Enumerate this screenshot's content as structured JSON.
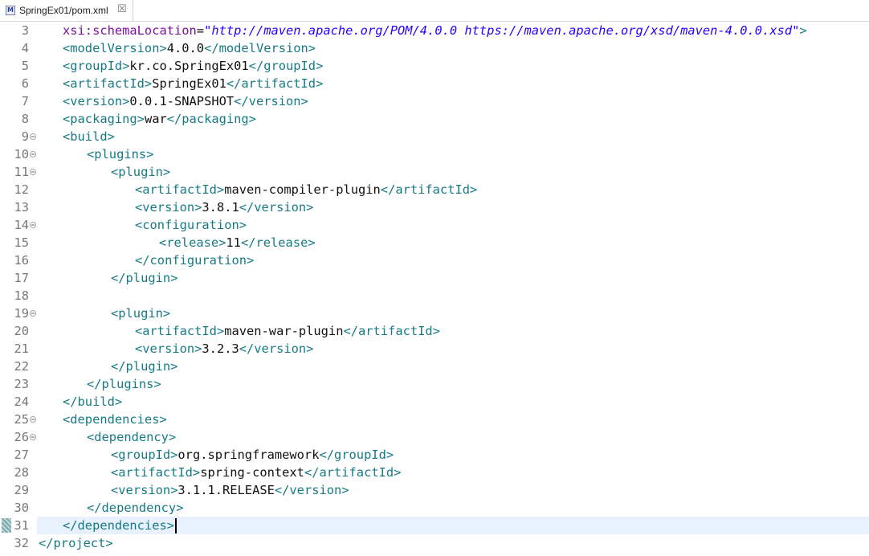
{
  "tab": {
    "title": "SpringEx01/pom.xml",
    "icon": "maven-file-icon",
    "icon_letter": "M",
    "close_symbol": "☒"
  },
  "current_line": 31,
  "lines": [
    {
      "n": "3",
      "fold": false,
      "indent": 1,
      "parts": [
        [
          "at",
          "xsi:schemaLocation"
        ],
        [
          "tx",
          "="
        ],
        [
          "av",
          "\"http://maven.apache.org/POM/4.0.0 https://maven.apache.org/xsd/maven-4.0.0.xsd\""
        ],
        [
          "tg",
          ">"
        ]
      ]
    },
    {
      "n": "4",
      "fold": false,
      "indent": 1,
      "parts": [
        [
          "tg",
          "<modelVersion>"
        ],
        [
          "tx",
          "4.0.0"
        ],
        [
          "tg",
          "</modelVersion>"
        ]
      ]
    },
    {
      "n": "5",
      "fold": false,
      "indent": 1,
      "parts": [
        [
          "tg",
          "<groupId>"
        ],
        [
          "tx",
          "kr.co.SpringEx01"
        ],
        [
          "tg",
          "</groupId>"
        ]
      ]
    },
    {
      "n": "6",
      "fold": false,
      "indent": 1,
      "parts": [
        [
          "tg",
          "<artifactId>"
        ],
        [
          "tx",
          "SpringEx01"
        ],
        [
          "tg",
          "</artifactId>"
        ]
      ]
    },
    {
      "n": "7",
      "fold": false,
      "indent": 1,
      "parts": [
        [
          "tg",
          "<version>"
        ],
        [
          "tx",
          "0.0.1-SNAPSHOT"
        ],
        [
          "tg",
          "</version>"
        ]
      ]
    },
    {
      "n": "8",
      "fold": false,
      "indent": 1,
      "parts": [
        [
          "tg",
          "<packaging>"
        ],
        [
          "tx",
          "war"
        ],
        [
          "tg",
          "</packaging>"
        ]
      ]
    },
    {
      "n": "9",
      "fold": true,
      "indent": 1,
      "parts": [
        [
          "tg",
          "<build>"
        ]
      ]
    },
    {
      "n": "10",
      "fold": true,
      "indent": 2,
      "parts": [
        [
          "tg",
          "<plugins>"
        ]
      ]
    },
    {
      "n": "11",
      "fold": true,
      "indent": 3,
      "parts": [
        [
          "tg",
          "<plugin>"
        ]
      ]
    },
    {
      "n": "12",
      "fold": false,
      "indent": 4,
      "parts": [
        [
          "tg",
          "<artifactId>"
        ],
        [
          "tx",
          "maven-compiler-plugin"
        ],
        [
          "tg",
          "</artifactId>"
        ]
      ]
    },
    {
      "n": "13",
      "fold": false,
      "indent": 4,
      "parts": [
        [
          "tg",
          "<version>"
        ],
        [
          "tx",
          "3.8.1"
        ],
        [
          "tg",
          "</version>"
        ]
      ]
    },
    {
      "n": "14",
      "fold": true,
      "indent": 4,
      "parts": [
        [
          "tg",
          "<configuration>"
        ]
      ]
    },
    {
      "n": "15",
      "fold": false,
      "indent": 5,
      "parts": [
        [
          "tg",
          "<release>"
        ],
        [
          "tx",
          "11"
        ],
        [
          "tg",
          "</release>"
        ]
      ]
    },
    {
      "n": "16",
      "fold": false,
      "indent": 4,
      "parts": [
        [
          "tg",
          "</configuration>"
        ]
      ]
    },
    {
      "n": "17",
      "fold": false,
      "indent": 3,
      "parts": [
        [
          "tg",
          "</plugin>"
        ]
      ]
    },
    {
      "n": "18",
      "fold": false,
      "indent": 0,
      "parts": []
    },
    {
      "n": "19",
      "fold": true,
      "indent": 3,
      "parts": [
        [
          "tg",
          "<plugin>"
        ]
      ]
    },
    {
      "n": "20",
      "fold": false,
      "indent": 4,
      "parts": [
        [
          "tg",
          "<artifactId>"
        ],
        [
          "tx",
          "maven-war-plugin"
        ],
        [
          "tg",
          "</artifactId>"
        ]
      ]
    },
    {
      "n": "21",
      "fold": false,
      "indent": 4,
      "parts": [
        [
          "tg",
          "<version>"
        ],
        [
          "tx",
          "3.2.3"
        ],
        [
          "tg",
          "</version>"
        ]
      ]
    },
    {
      "n": "22",
      "fold": false,
      "indent": 3,
      "parts": [
        [
          "tg",
          "</plugin>"
        ]
      ]
    },
    {
      "n": "23",
      "fold": false,
      "indent": 2,
      "parts": [
        [
          "tg",
          "</plugins>"
        ]
      ]
    },
    {
      "n": "24",
      "fold": false,
      "indent": 1,
      "parts": [
        [
          "tg",
          "</build>"
        ]
      ]
    },
    {
      "n": "25",
      "fold": true,
      "indent": 1,
      "parts": [
        [
          "tg",
          "<dependencies>"
        ]
      ]
    },
    {
      "n": "26",
      "fold": true,
      "indent": 2,
      "parts": [
        [
          "tg",
          "<dependency>"
        ]
      ]
    },
    {
      "n": "27",
      "fold": false,
      "indent": 3,
      "parts": [
        [
          "tg",
          "<groupId>"
        ],
        [
          "tx",
          "org.springframework"
        ],
        [
          "tg",
          "</groupId>"
        ]
      ]
    },
    {
      "n": "28",
      "fold": false,
      "indent": 3,
      "parts": [
        [
          "tg",
          "<artifactId>"
        ],
        [
          "tx",
          "spring-context"
        ],
        [
          "tg",
          "</artifactId>"
        ]
      ]
    },
    {
      "n": "29",
      "fold": false,
      "indent": 3,
      "parts": [
        [
          "tg",
          "<version>"
        ],
        [
          "tx",
          "3.1.1.RELEASE"
        ],
        [
          "tg",
          "</version>"
        ]
      ]
    },
    {
      "n": "30",
      "fold": false,
      "indent": 2,
      "parts": [
        [
          "tg",
          "</dependency>"
        ]
      ]
    },
    {
      "n": "31",
      "fold": false,
      "indent": 1,
      "parts": [
        [
          "tg",
          "</dependencies>"
        ]
      ]
    },
    {
      "n": "32",
      "fold": false,
      "indent": 0,
      "parts": [
        [
          "tg",
          "</project>"
        ]
      ]
    }
  ]
}
